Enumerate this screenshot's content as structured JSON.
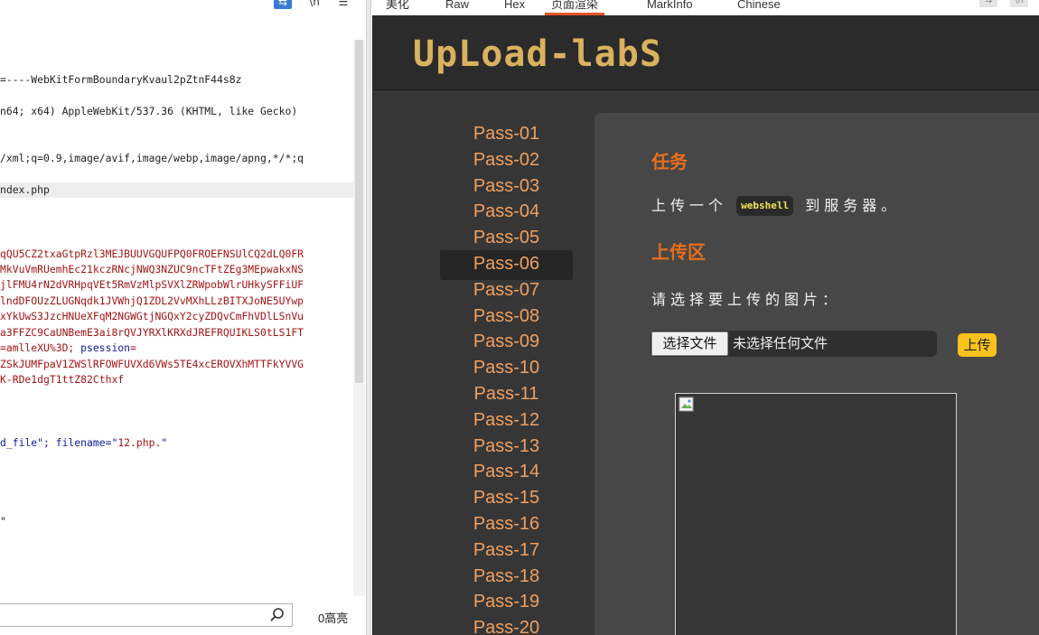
{
  "request_editor": {
    "toolbar": {
      "wrap_icon": "wrap-icon",
      "newline_label": "\\n",
      "menu_icon": "menu-icon"
    },
    "lines": [
      {
        "text": "=----WebKitFormBoundaryKvaul2pZtnF44s8z",
        "style": "plain"
      },
      {
        "text": "n64; x64) AppleWebKit/537.36 (KHTML, like Gecko)",
        "style": "plain"
      },
      {
        "text": "/xml;q=0.9,image/avif,image/webp,image/apng,*/*;q",
        "style": "plain"
      },
      {
        "text": "ndex.php",
        "style": "highlight"
      },
      {
        "text": "qQU5CZ2txaGtpRzl3MEJBUUVGQUFPQ0FROEFNSUlCQ2dLQ0FR",
        "style": "red"
      },
      {
        "text": "MkVuVmRUemhEc21kczRNcjNWQ3NZUC9ncTFtZEg3MEpwakxNS",
        "style": "red"
      },
      {
        "text": "jlFMU4rN2dVRHpqVEt5RmVzMlpSVXlZRWpobWlrUHkySFFiUF",
        "style": "red"
      },
      {
        "text": "lndDFOUzZLUGNqdk1JVWhjQ1ZDL2VvMXhLLzBITXJoNE5UYwp",
        "style": "red"
      },
      {
        "text": "xYkUwS3JzcHNUeXFqM2NGWGtjNGQxY2cyZDQvCmFhVDlLSnVu",
        "style": "red"
      },
      {
        "text": "a3FFZC9CaUNBemE3ai8rQVJYRXlKRXdJREFRQUIKLS0tLS1FT",
        "style": "red"
      },
      {
        "text": "=amlleXU%3D; ",
        "style": "mixed",
        "key": "psession",
        "after": "="
      },
      {
        "text": "ZSkJUMFpaV1ZWSlRFOWFUVXd6VWs5TE4xcEROVXhMTTFkYVVG",
        "style": "red"
      },
      {
        "text": "K-RDe1dgT1ttZ82Cthxf",
        "style": "red"
      },
      {
        "text": "d_file\"; filename=\"",
        "style": "filename",
        "value": "12.php.",
        "after": "\""
      },
      {
        "text": "\"",
        "style": "plain"
      }
    ],
    "search": {
      "placeholder": "",
      "value": "",
      "icon": "search-icon",
      "highlight_count": "0高亮"
    }
  },
  "response_viewer": {
    "tabs": [
      {
        "label": "美化",
        "active": false
      },
      {
        "label": "Raw",
        "active": false
      },
      {
        "label": "Hex",
        "active": false
      },
      {
        "label": "页面渲染",
        "active": true
      },
      {
        "label": "MarkInfo",
        "active": false
      },
      {
        "label": "Chinese",
        "active": false
      }
    ],
    "accent_color": "#e8562a",
    "rendered_page": {
      "logo_text": "UpLoad-labS",
      "nav_items": [
        "Pass-01",
        "Pass-02",
        "Pass-03",
        "Pass-04",
        "Pass-05",
        "Pass-06",
        "Pass-07",
        "Pass-08",
        "Pass-09",
        "Pass-10",
        "Pass-11",
        "Pass-12",
        "Pass-13",
        "Pass-14",
        "Pass-15",
        "Pass-16",
        "Pass-17",
        "Pass-18",
        "Pass-19",
        "Pass-20"
      ],
      "active_nav": "Pass-06",
      "task_title": "任务",
      "task_text_before": "上传一个",
      "task_code": "webshell",
      "task_text_after": "到服务器。",
      "upload_title": "上传区",
      "choose_label": "请选择要上传的图片：",
      "file_button_label": "选择文件",
      "file_status": "未选择任何文件",
      "upload_button_label": "上传",
      "preview_icon": "broken-image-icon",
      "colors": {
        "background": "#363636",
        "header": "#2b2b2b",
        "panel": "#474747",
        "nav_text": "#f0a060",
        "section_title": "#e86e1c",
        "logo": "#d9b25f",
        "upload_button": "#f7c21b",
        "code_badge_text": "#f5e35a"
      }
    }
  }
}
